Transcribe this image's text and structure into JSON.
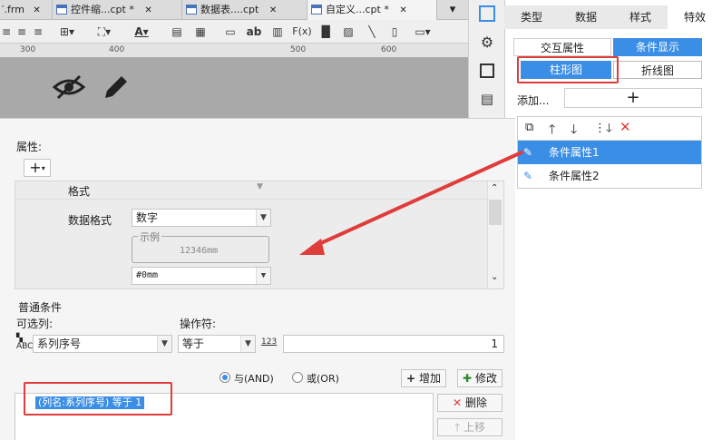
{
  "file_tabs": [
    {
      "label": "′.frm",
      "close": "✕"
    },
    {
      "label": "控件缩...cpt *",
      "close": "✕"
    },
    {
      "label": "数据表....cpt",
      "close": "✕"
    },
    {
      "label": "自定义...cpt *",
      "close": "✕"
    }
  ],
  "ruler_marks": [
    "300",
    "400",
    "500",
    "600"
  ],
  "right_panel": {
    "tabs": [
      "类型",
      "数据",
      "样式",
      "特效"
    ],
    "subtabs": [
      "交互属性",
      "条件显示"
    ],
    "chart_types": [
      "柱形图",
      "折线图"
    ],
    "add_label": "添加...",
    "add_button": "+",
    "conditions": [
      "条件属性1",
      "条件属性2"
    ]
  },
  "dialog": {
    "attributes_label": "属性:",
    "add_button": "+",
    "format_label": "格式",
    "data_format_label": "数据格式",
    "data_format_value": "数字",
    "example_label": "示例",
    "example_value": "12346mm",
    "pattern_value": "#0mm",
    "normal_condition_label": "普通条件",
    "optional_col_label": "可选列:",
    "operator_label": "操作符:",
    "column_value": "系列序号",
    "operator_value": "等于",
    "value_type_icon": "123",
    "value": "1",
    "and_label": "与(AND)",
    "or_label": "或(OR)",
    "add_cond_button": "增加",
    "modify_button": "修改",
    "delete_button": "删除",
    "up_button": "上移",
    "condition_expr": "(列名:系列序号) 等于 1"
  },
  "colors": {
    "accent": "#3b8ee6",
    "highlight_red": "#e03c3c",
    "selected_row": "#3b8ee6"
  }
}
